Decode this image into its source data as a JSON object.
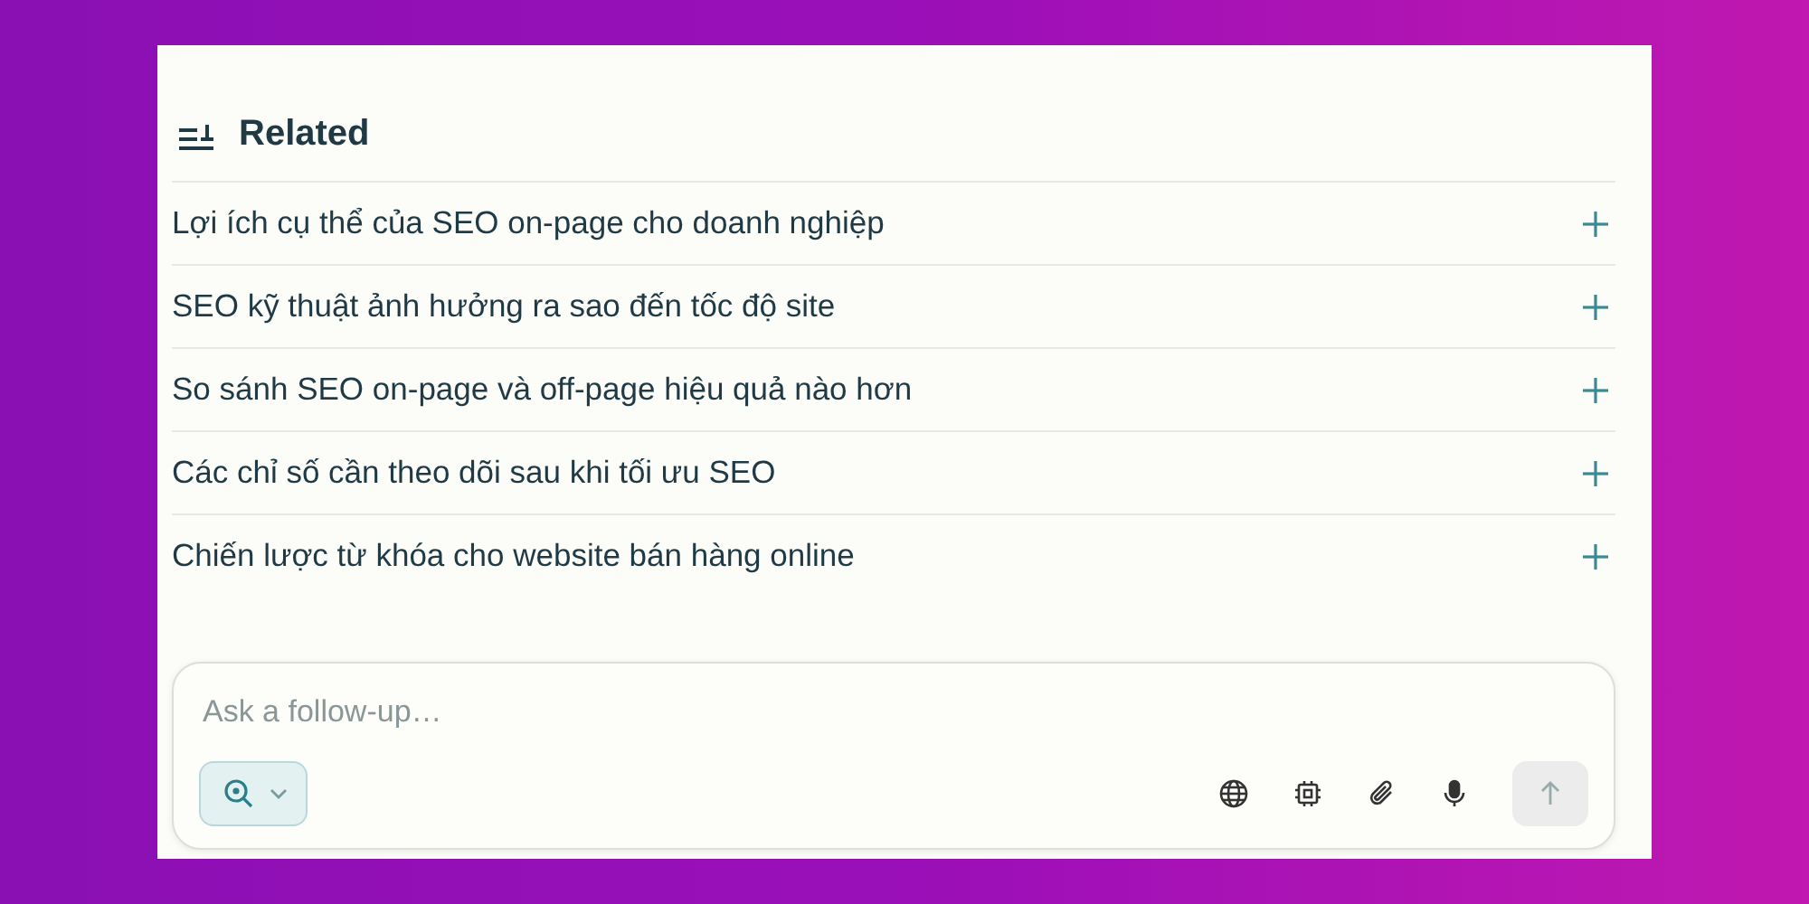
{
  "related": {
    "title": "Related",
    "items": [
      {
        "label": "Lợi ích cụ thể của SEO on-page cho doanh nghiệp"
      },
      {
        "label": "SEO kỹ thuật ảnh hưởng ra sao đến tốc độ site"
      },
      {
        "label": "So sánh SEO on-page và off-page hiệu quả nào hơn"
      },
      {
        "label": "Các chỉ số cần theo dõi sau khi tối ưu SEO"
      },
      {
        "label": "Chiến lược từ khóa cho website bán hàng online"
      }
    ]
  },
  "composer": {
    "placeholder": "Ask a follow-up…",
    "send_disabled": true
  }
}
